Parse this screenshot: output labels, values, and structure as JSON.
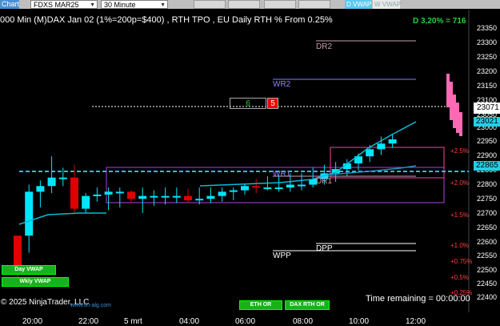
{
  "toolbar": {
    "chart_tab": "Chart",
    "instrument": "FDXS MAR25",
    "interval": "30 Minute",
    "d_vwap": "D VWAP",
    "w_vwap": "W VWAP"
  },
  "title": "000 Min (M)DAX Jan 02 (1%=200p=$400) , RTH TPO , EU Daily RTH % From 0.25%",
  "stat_badge": "D 3,20% = 716",
  "price_axis": [
    "23350",
    "23300",
    "23250",
    "23200",
    "23150",
    "23100",
    "23050",
    "23000",
    "22950",
    "22900",
    "22850",
    "22800",
    "22750",
    "22700",
    "22650",
    "22600",
    "22550",
    "22500",
    "22450",
    "22400"
  ],
  "price_tags": {
    "last": "23071",
    "cyan1": "23021",
    "cyan2": "22865",
    "hidden": "23000"
  },
  "time_axis": [
    "20:00",
    "22:00",
    "5 mrt",
    "04:00",
    "06:00",
    "08:00",
    "10:00",
    "12:00"
  ],
  "levels": {
    "dr2": "DR2",
    "wr2": "WR2",
    "wr1": "WR1",
    "dr1": "DR1",
    "wpp": "WPP",
    "dpp": "DPP"
  },
  "pct_labels": [
    "+2.5%",
    "+2.0%",
    "+1.5%",
    "+1.0%",
    "+0.75%",
    "+0.5%",
    "+0.25%"
  ],
  "counter_box": {
    "left": "6",
    "right": "5"
  },
  "buttons": {
    "day_vwap": "Day VWAP",
    "wkly_vwap": "Wkly VWAP",
    "eth_or": "ETH OR",
    "dax_rth_or": "DAX RTH OR"
  },
  "footer": {
    "copyright": "© 2025 NinjaTrader, LLC",
    "site": "www.fin-alg.com",
    "timer": "Time remaining = 00:00:00"
  },
  "colors": {
    "bull_candle": "#00e5ff",
    "bear_candle": "#e00000",
    "tpo_candle": "#ff69b4",
    "vwap": "#00bcd4",
    "level_box": "#b040e0"
  },
  "chart_data": {
    "type": "candlestick",
    "x": [
      "19:30",
      "20:00",
      "20:30",
      "21:00",
      "21:30",
      "22:00",
      "22:30",
      "23:00",
      "23:30",
      "00:00",
      "00:30",
      "01:00",
      "01:30",
      "02:00",
      "02:30",
      "03:00",
      "03:30",
      "04:00",
      "04:30",
      "05:00",
      "05:30",
      "06:00",
      "06:30",
      "07:00",
      "07:30",
      "08:00",
      "08:30",
      "09:00",
      "09:30",
      "10:00",
      "10:30",
      "11:00",
      "11:30",
      "12:00"
    ],
    "series": [
      {
        "open": [
          22510,
          22620,
          22775,
          22795,
          22825,
          22825,
          22715,
          22760,
          22765,
          22775,
          22775,
          22750,
          22760,
          22760,
          22760,
          22760,
          22745,
          22750,
          22760,
          22775,
          22780,
          22795,
          22790,
          22790,
          22790,
          22800,
          22800,
          22820,
          22840,
          22855,
          22875,
          22900,
          22925,
          22945
        ],
        "high": [
          22580,
          22800,
          22815,
          22900,
          22860,
          22870,
          22770,
          22790,
          22790,
          22790,
          22780,
          22790,
          22780,
          22790,
          22790,
          22785,
          22790,
          22790,
          22790,
          22790,
          22800,
          22820,
          22830,
          22830,
          22840,
          22840,
          22860,
          22870,
          22880,
          22890,
          22910,
          22940,
          22970,
          22980
        ],
        "low": [
          22455,
          22560,
          22720,
          22770,
          22795,
          22700,
          22700,
          22740,
          22710,
          22720,
          22735,
          22700,
          22725,
          22730,
          22735,
          22735,
          22730,
          22735,
          22740,
          22745,
          22765,
          22770,
          22780,
          22775,
          22775,
          22780,
          22790,
          22800,
          22810,
          22830,
          22850,
          22880,
          22905,
          22930
        ],
        "close": [
          22620,
          22775,
          22795,
          22825,
          22825,
          22715,
          22760,
          22765,
          22775,
          22775,
          22750,
          22760,
          22760,
          22760,
          22760,
          22745,
          22750,
          22760,
          22775,
          22780,
          22795,
          22790,
          22790,
          22790,
          22800,
          22800,
          22820,
          22840,
          22855,
          22875,
          22900,
          22925,
          22945,
          22960
        ]
      }
    ],
    "ylim": [
      22400,
      23350
    ]
  }
}
